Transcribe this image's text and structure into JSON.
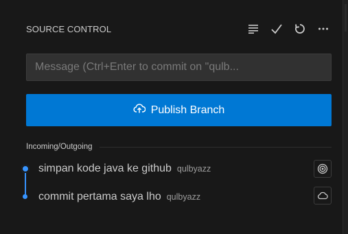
{
  "header": {
    "title": "SOURCE CONTROL",
    "actions": [
      {
        "icon": "view-as-list-icon"
      },
      {
        "icon": "checkmark-icon"
      },
      {
        "icon": "refresh-icon"
      },
      {
        "icon": "more-actions-icon"
      }
    ]
  },
  "commit_input": {
    "placeholder": "Message (Ctrl+Enter to commit on \"qulb..."
  },
  "publish": {
    "label": "Publish Branch",
    "icon": "cloud-upload-icon"
  },
  "graph": {
    "section_title": "Incoming/Outgoing",
    "commits": [
      {
        "message": "simpan kode java ke github",
        "author": "qulbyazz",
        "icon": "target-icon"
      },
      {
        "message": "commit pertama saya lho",
        "author": "qulbyazz",
        "icon": "cloud-icon"
      }
    ]
  },
  "colors": {
    "background": "#181818",
    "accent": "#0078d4",
    "graph": "#3794ff",
    "input_bg": "#313131"
  }
}
